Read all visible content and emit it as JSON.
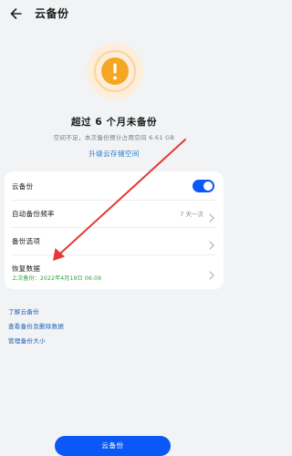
{
  "header": {
    "title": "云备份",
    "back_icon": "back-arrow-icon"
  },
  "status": {
    "icon": "warning-icon",
    "accent_color": "#f5a623",
    "title": "超过 6 个月未备份",
    "description": "空间不足，本次备份预计占用空间 6.61 GB",
    "upgrade_link": "升级云存储空间"
  },
  "settings": {
    "cloud_backup": {
      "label": "云备份",
      "enabled": true
    },
    "auto_frequency": {
      "label": "自动备份频率",
      "value": "7 天一次"
    },
    "backup_options": {
      "label": "备份选项"
    },
    "restore_data": {
      "label": "恢复数据",
      "sub": "上次备份：2022年4月19日 06:09"
    }
  },
  "links": {
    "learn_more": "了解云备份",
    "view_records": "查看备份及删除数据",
    "manage_size": "管理备份大小"
  },
  "primary_button": "云备份",
  "colors": {
    "primary": "#0a59f7",
    "success": "#2b9e3a",
    "link": "#1f7ccc",
    "annotation": "#e53935"
  }
}
